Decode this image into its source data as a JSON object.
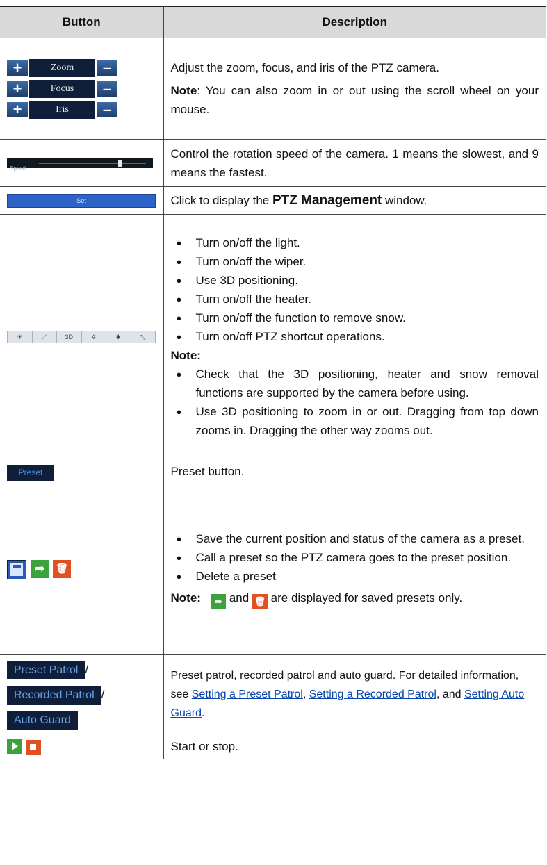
{
  "headers": {
    "button": "Button",
    "description": "Description"
  },
  "zfi": {
    "rows": [
      {
        "plus": "+",
        "label": "Zoom",
        "minus": "–"
      },
      {
        "plus": "+",
        "label": "Focus",
        "minus": "–"
      },
      {
        "plus": "+",
        "label": "Iris",
        "minus": "–"
      }
    ],
    "desc": "Adjust the zoom, focus, and iris of the PTZ camera.",
    "note_label": "Note",
    "note_text": ": You can also zoom in or out using the scroll wheel on your mouse."
  },
  "speed": {
    "label": "Speed",
    "level": 0.75,
    "desc": "Control the rotation speed of the camera. 1 means the slowest, and 9 means the fastest."
  },
  "set": {
    "label": "Set",
    "desc_pre": "Click to display the ",
    "desc_bold": "PTZ Management",
    "desc_post": " window."
  },
  "toolbar": {
    "icons": [
      "light-icon",
      "wiper-icon",
      "3d-positioning-icon",
      "heater-icon",
      "snow-removal-icon",
      "shortcut-icon"
    ],
    "glyphs": [
      "☀",
      "⟋",
      "3D",
      "✲",
      "✱",
      "⤡"
    ],
    "items": [
      "Turn on/off the light.",
      "Turn on/off the wiper.",
      "Use 3D positioning.",
      "Turn on/off the heater.",
      "Turn on/off the function to remove snow.",
      "Turn on/off PTZ shortcut operations."
    ],
    "note_label": "Note:",
    "notes": [
      "Check that the 3D positioning, heater and snow removal functions are supported by the camera before using.",
      "Use 3D positioning to zoom in or out. Dragging from top down zooms in. Dragging the other way zooms out."
    ]
  },
  "preset": {
    "label": "Preset",
    "desc": "Preset button."
  },
  "preset_ops": {
    "icons": [
      "save-icon",
      "call-preset-icon",
      "delete-icon"
    ],
    "items": [
      "Save the current position and status of the camera as a preset.",
      "Call a preset so the PTZ camera goes to the preset position.",
      "Delete a preset"
    ],
    "note_label": "Note:",
    "note_and": " and ",
    "note_tail": " are displayed for saved presets only."
  },
  "patrol": {
    "buttons": [
      "Preset Patrol",
      "Recorded Patrol",
      "Auto Guard"
    ],
    "slash": "/",
    "desc_pre": "Preset patrol, recorded patrol and auto guard. For detailed information, see ",
    "links": [
      "Setting a Preset Patrol",
      "Setting a Recorded Patrol",
      "Setting Auto Guard"
    ],
    "sep1": ", ",
    "sep2": ", and ",
    "desc_post": "."
  },
  "startstop": {
    "desc": "Start or stop."
  },
  "colors": {
    "header_bg": "#d9d9d9",
    "dark_button": "#0f1f3a",
    "accent_blue": "#2d62c7",
    "link": "#0645ad"
  }
}
